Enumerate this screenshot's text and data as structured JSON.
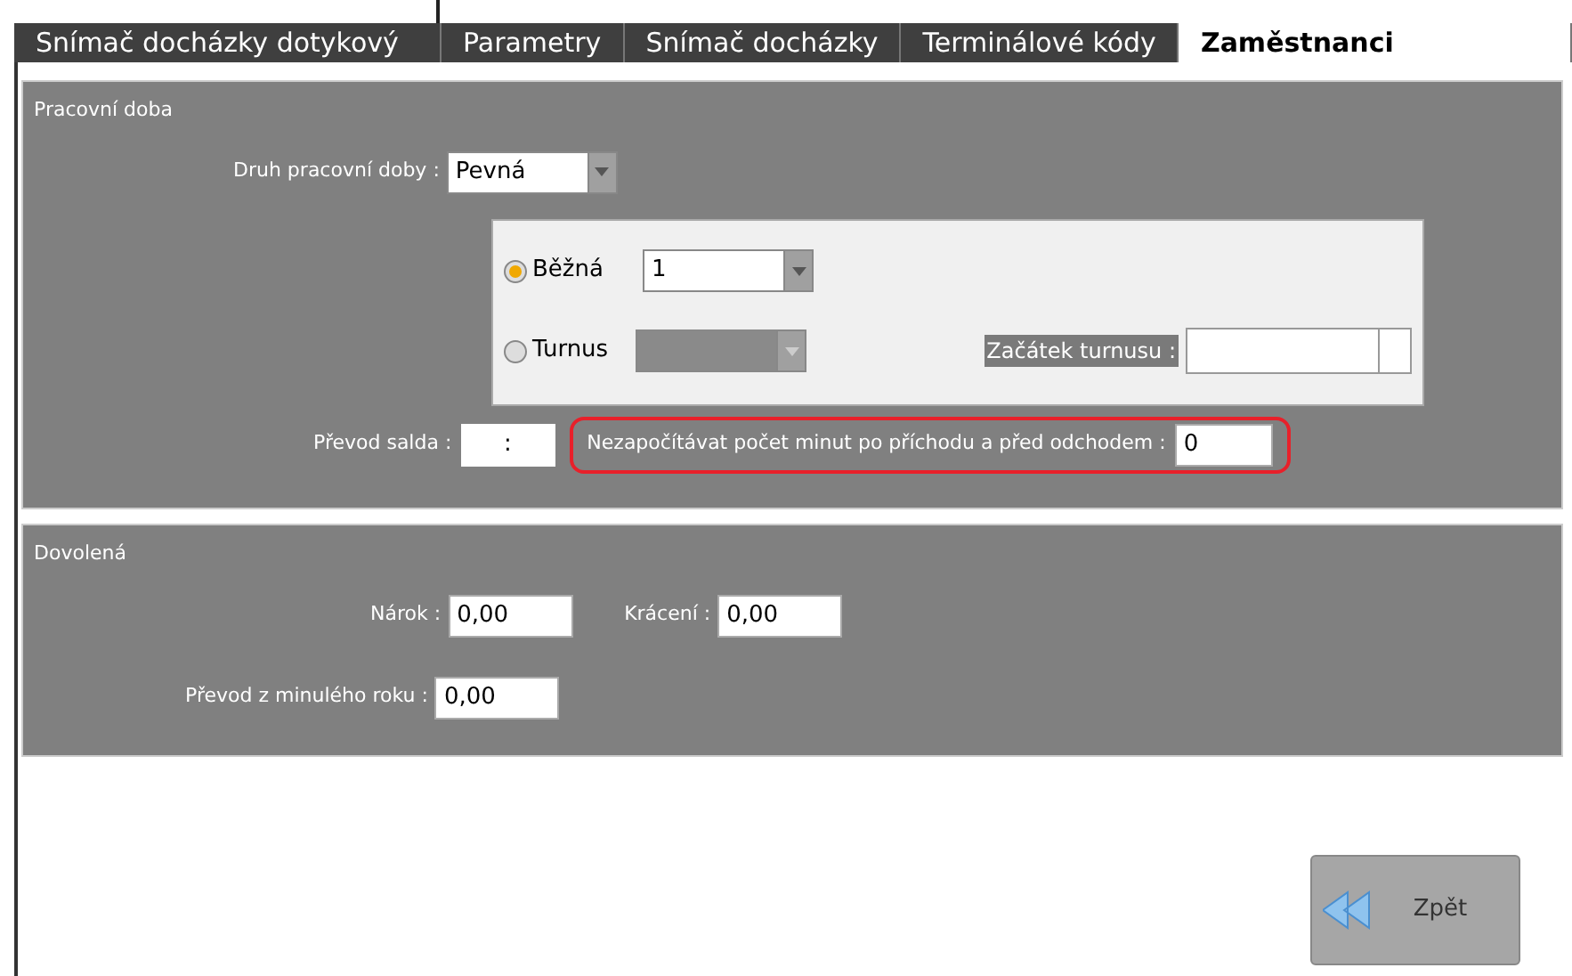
{
  "tabs": [
    {
      "label": "Snímač docházky dotykový",
      "selected": false
    },
    {
      "label": "Parametry",
      "selected": false
    },
    {
      "label": "Snímač docházky",
      "selected": false
    },
    {
      "label": "Terminálové kódy",
      "selected": false
    },
    {
      "label": "Zaměstnanci",
      "selected": true
    }
  ],
  "work_time": {
    "title": "Pracovní doba",
    "type_label": "Druh pracovní doby :",
    "type_value": "Pevná",
    "options": [
      {
        "label": "Běžná",
        "selected": true,
        "value": "1"
      },
      {
        "label": "Turnus",
        "selected": false
      }
    ],
    "shift_start_label": "Začátek turnusu :",
    "balance_label": "Převod salda :",
    "balance_value": ":",
    "ignore_label": "Nezapočítávat počet minut po příchodu a před odchodem :",
    "ignore_value": "0",
    "ignore_highlighted": true
  },
  "vacation": {
    "title": "Dovolená",
    "claim_label": "Nárok :",
    "claim_value": "0,00",
    "reduction_label": "Krácení :",
    "reduction_value": "0,00",
    "carryover_label": "Převod z minulého roku :",
    "carryover_value": "0,00"
  },
  "back_button": {
    "label": "Zpět"
  }
}
